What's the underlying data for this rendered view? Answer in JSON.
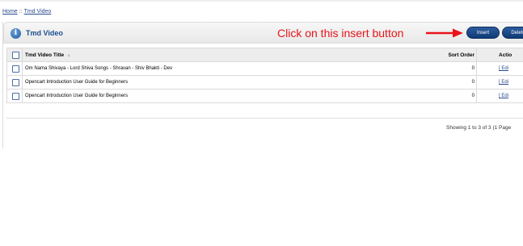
{
  "breadcrumb": {
    "home": "Home",
    "separator": "::",
    "current": "Tmd Video"
  },
  "heading": {
    "title": "Tmd Video",
    "icon": "info-icon"
  },
  "annotation": {
    "text": "Click on this insert button",
    "color": "#e8141a"
  },
  "buttons": {
    "insert": "Insert",
    "delete": "Delete"
  },
  "table": {
    "columns": {
      "title": "Tmd Video Title",
      "sort_order": "Sort Order",
      "action": "Actio"
    },
    "rows": [
      {
        "title": "Om Nama Shivaya - Lord Shiva Songs - Shravan - Shiv Bhakti - Dev",
        "sort_order": "0",
        "action": "[ Edi"
      },
      {
        "title": "Opencart Introduction User Guide for Beginners",
        "sort_order": "0",
        "action": "[ Edi"
      },
      {
        "title": "Opencart Introduction User Guide for Beginners",
        "sort_order": "0",
        "action": "[ Edi"
      }
    ]
  },
  "pagination": {
    "text": "Showing 1 to 3 of 3 (1 Page"
  },
  "colors": {
    "accent": "#1c4e8e",
    "button": "#1f4d8c",
    "link": "#2a4a8c"
  }
}
